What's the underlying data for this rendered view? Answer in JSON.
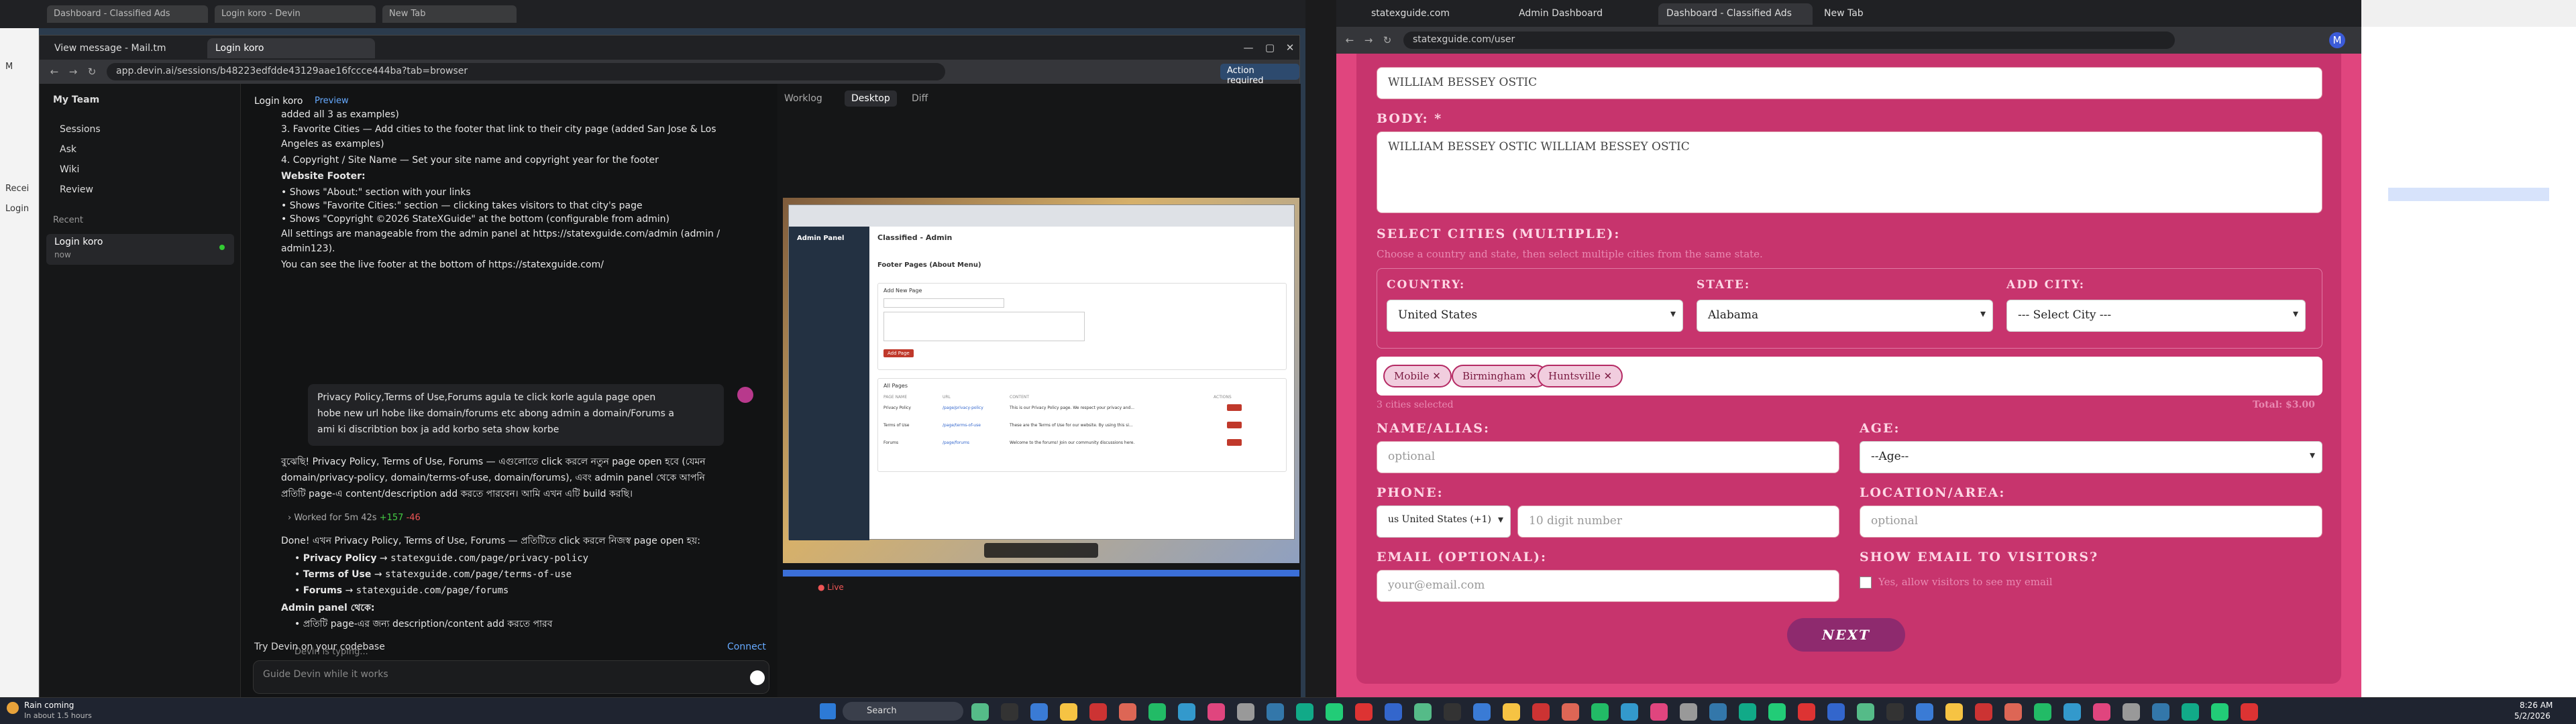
{
  "left_browser": {
    "tabs": [
      "View message - Mail.tm",
      "Login koro"
    ],
    "url": "app.devin.ai/sessions/b48223edfdde43129aae16fccce444ba?tab=browser",
    "action_badge": "Action required"
  },
  "devin": {
    "team": "My Team",
    "nav": [
      "Sessions",
      "Ask",
      "Wiki",
      "Review"
    ],
    "recent_label": "Recent",
    "recent_item": "Login koro",
    "recent_time": "now",
    "session_title": "Login koro",
    "preview_badge": "Preview",
    "panel_tabs": [
      "Worklog",
      "Desktop",
      "Diff"
    ],
    "chat_lines": [
      "added all 3 as examples)",
      "3. Favorite Cities — Add cities to the footer that link to their city page (added San Jose & Los",
      "Angeles as examples)",
      "4. Copyright / Site Name — Set your site name and copyright year for the footer",
      "Website Footer:",
      "• Shows \"About:\" section with your links",
      "• Shows \"Favorite Cities:\" section — clicking takes visitors to that city's page",
      "• Shows \"Copyright ©2026 StateXGuide\" at the bottom (configurable from admin)",
      "All settings are manageable from the admin panel at https://statexguide.com/admin (admin /",
      "admin123).",
      "You can see the live footer at the bottom of https://statexguide.com/"
    ],
    "user_msg": [
      "Privacy Policy,Terms of Use,Forums agula te click korle agula page open",
      "hobe new url hobe like domain/forums etc abong admin a domain/Forums a",
      "ami ki discribtion box ja add korbo seta show korbe"
    ],
    "reply_lines": [
      "বুঝেছি! Privacy Policy, Terms of Use, Forums — এগুলোতে click করলে নতুন page open হবে (যেমন",
      "domain/privacy-policy, domain/terms-of-use, domain/forums), এবং admin panel থেকে আপনি",
      "প্রতিটি page-এ content/description add করতে পারবেন। আমি এখন এটি build করছি।"
    ],
    "worked": "Worked for 5m 42s",
    "added": "+157",
    "removed": "-46",
    "done_line": "Done! এখন Privacy Policy, Terms of Use, Forums — প্রতিটিতে click করলে নিজস্ব page open হয়:",
    "pages": [
      {
        "name": "Privacy Policy",
        "url": "statexguide.com/page/privacy-policy"
      },
      {
        "name": "Terms of Use",
        "url": "statexguide.com/page/terms-of-use"
      },
      {
        "name": "Forums",
        "url": "statexguide.com/page/forums"
      }
    ],
    "admin_line": "Admin panel থেকে:",
    "admin_bullet": "প্রতিটি page-এর জন্য description/content add করতে পারব",
    "typing": "Devin is typing...",
    "codebase": "Try Devin on your codebase",
    "connect": "Connect",
    "input_placeholder": "Guide Devin while it works",
    "live": "Live"
  },
  "inner": {
    "admin_title": "Admin Panel",
    "page_title": "Classified - Admin",
    "section_title": "Footer Pages (About Menu)",
    "add_title": "Add New Page",
    "add_btn": "Add Page",
    "list_title": "All Pages",
    "cols": [
      "PAGE NAME",
      "URL",
      "CONTENT",
      "ACTIONS"
    ],
    "rows": [
      [
        "Privacy Policy",
        "/page/privacy-policy",
        "This is our Privacy Policy page. We respect your privacy and..."
      ],
      [
        "Terms of Use",
        "/page/terms-of-use",
        "These are the Terms of Use for our website. By using this si..."
      ],
      [
        "Forums",
        "/page/forums",
        "Welcome to the forums! Join our community discussions here."
      ]
    ]
  },
  "right_browser": {
    "tabs": [
      "statexguide.com",
      "Admin Dashboard",
      "Dashboard - Classified Ads",
      "New Tab"
    ],
    "url": "statexguide.com/user"
  },
  "form": {
    "title_value": "WILLIAM BESSEY OSTIC",
    "body_label": "BODY: *",
    "body_value": "WILLIAM BESSEY OSTIC WILLIAM BESSEY OSTIC",
    "cities_label": "SELECT CITIES (MULTIPLE):",
    "cities_hint": "Choose a country and state, then select multiple cities from the same state.",
    "country_label": "COUNTRY:",
    "country_value": "United States",
    "state_label": "STATE:",
    "state_value": "Alabama",
    "addcity_label": "ADD CITY:",
    "addcity_value": "--- Select City ---",
    "chips": [
      "Mobile",
      "Birmingham",
      "Huntsville"
    ],
    "cities_selected": "3 cities selected",
    "total": "Total: $3.00",
    "name_label": "NAME/ALIAS:",
    "name_placeholder": "optional",
    "age_label": "AGE:",
    "age_value": "--Age--",
    "phone_label": "PHONE:",
    "phone_code": "us United States (+1)",
    "phone_placeholder": "10 digit number",
    "location_label": "LOCATION/AREA:",
    "location_placeholder": "optional",
    "email_label": "EMAIL (OPTIONAL):",
    "email_placeholder": "your@email.com",
    "show_email_label": "SHOW EMAIL TO VISITORS?",
    "show_email_text": "Yes, allow visitors to see my email",
    "next": "NEXT"
  },
  "taskbar": {
    "weather": "Rain coming",
    "weather_sub": "In about 1.5 hours",
    "search": "Search",
    "time": "8:26 AM",
    "date": "5/2/2026"
  }
}
